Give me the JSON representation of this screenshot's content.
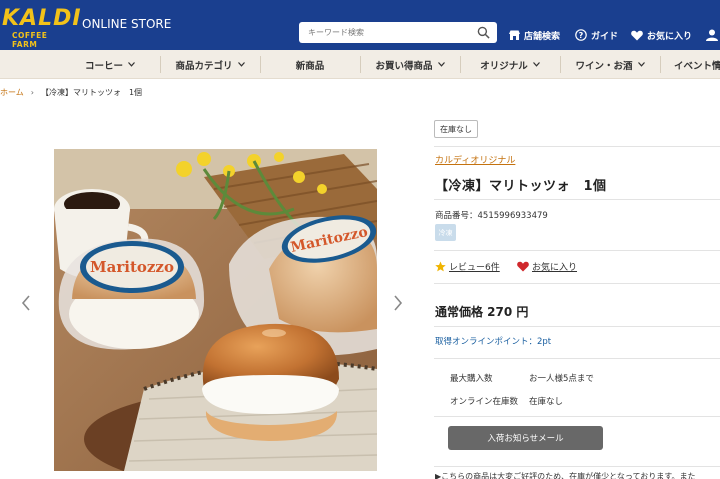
{
  "header": {
    "logo_text": "KALDI",
    "logo_sub": "COFFEE FARM",
    "store_label": "ONLINE STORE",
    "search_placeholder": "キーワード検索",
    "nav": [
      {
        "label": "店舗検索",
        "icon": "store-icon"
      },
      {
        "label": "ガイド",
        "icon": "help-icon"
      },
      {
        "label": "お気に入り",
        "icon": "heart-icon"
      }
    ],
    "colors": {
      "background": "#1a3f8f",
      "logo": "#f2c21a"
    }
  },
  "categories": [
    {
      "label": "コーヒー",
      "dropdown": true
    },
    {
      "label": "商品カテゴリ",
      "dropdown": true
    },
    {
      "label": "新商品",
      "dropdown": false
    },
    {
      "label": "お買い得商品",
      "dropdown": true
    },
    {
      "label": "オリジナル",
      "dropdown": true
    },
    {
      "label": "ワイン・お酒",
      "dropdown": true
    },
    {
      "label": "イベント情",
      "dropdown": false
    }
  ],
  "breadcrumb": {
    "home": "ホーム",
    "separator": "›",
    "current": "【冷凍】マリトッツォ　1個"
  },
  "product": {
    "stock_badge": "在庫なし",
    "brand": "カルディオリジナル",
    "title": "【冷凍】マリトッツォ　1個",
    "sku": "商品番号：4515996933479",
    "tag": "冷凍",
    "review": "レビュー6件",
    "favorite": "お気に入り",
    "price": "通常価格 270 円",
    "points": "取得オンラインポイント：2pt",
    "specs": [
      {
        "label": "最大購入数",
        "value": "お一人様5点まで"
      },
      {
        "label": "オンライン在庫数",
        "value": "在庫なし"
      }
    ],
    "notify_button": "入荷お知らせメール",
    "note": "▶こちらの商品は大変ご好評のため、在庫が僅少となっております。また"
  },
  "image": {
    "package_text": "Maritozzo",
    "prev": "‹",
    "next": "›"
  },
  "colors": {
    "accent_link": "#c4720f",
    "points_link": "#1a5fa0",
    "star": "#f0b400",
    "heart": "#d0282c",
    "button": "#686868",
    "category_bg": "#f2ede5"
  }
}
